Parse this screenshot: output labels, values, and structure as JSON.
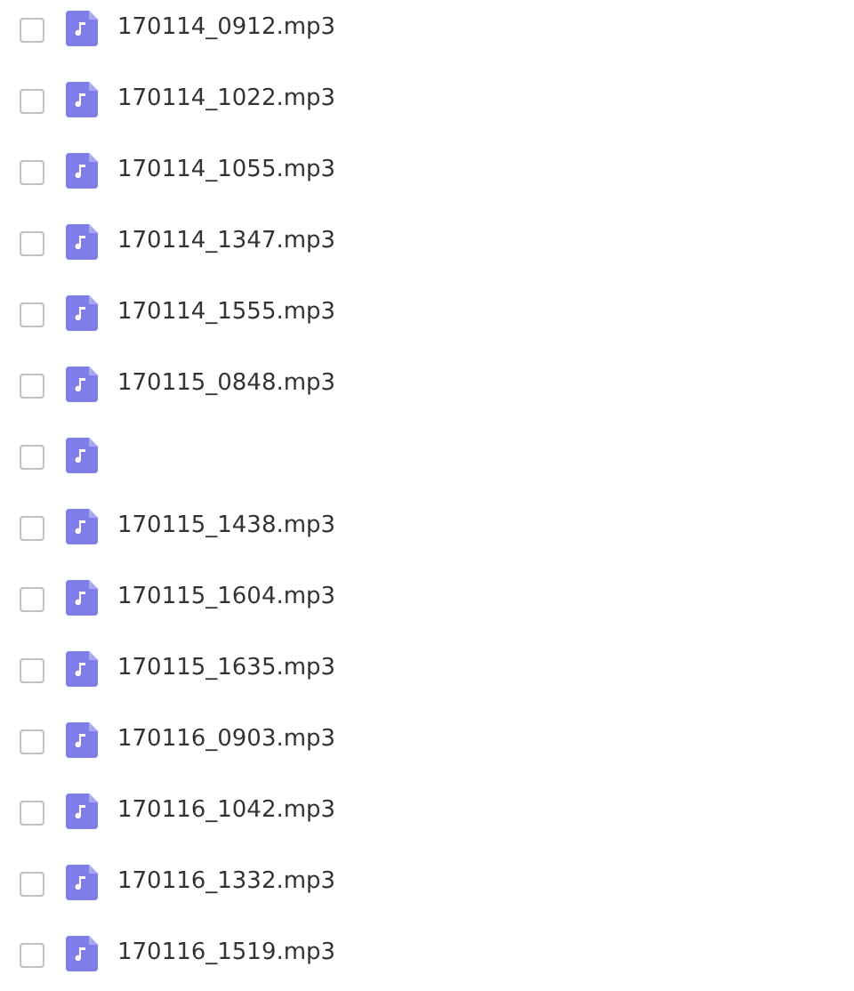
{
  "files": [
    {
      "name": "170114_0912.mp3",
      "checked": false
    },
    {
      "name": "170114_1022.mp3",
      "checked": false
    },
    {
      "name": "170114_1055.mp3",
      "checked": false
    },
    {
      "name": "170114_1347.mp3",
      "checked": false
    },
    {
      "name": "170114_1555.mp3",
      "checked": false
    },
    {
      "name": "170115_0848.mp3",
      "checked": false
    },
    {
      "checked": false
    },
    {
      "name": "170115_1438.mp3",
      "checked": false
    },
    {
      "name": "170115_1604.mp3",
      "checked": false
    },
    {
      "name": "170115_1635.mp3",
      "checked": false
    },
    {
      "name": "170116_0903.mp3",
      "checked": false
    },
    {
      "name": "170116_1042.mp3",
      "checked": false
    },
    {
      "name": "170116_1332.mp3",
      "checked": false
    },
    {
      "name": "170116_1519.mp3",
      "checked": false
    }
  ]
}
